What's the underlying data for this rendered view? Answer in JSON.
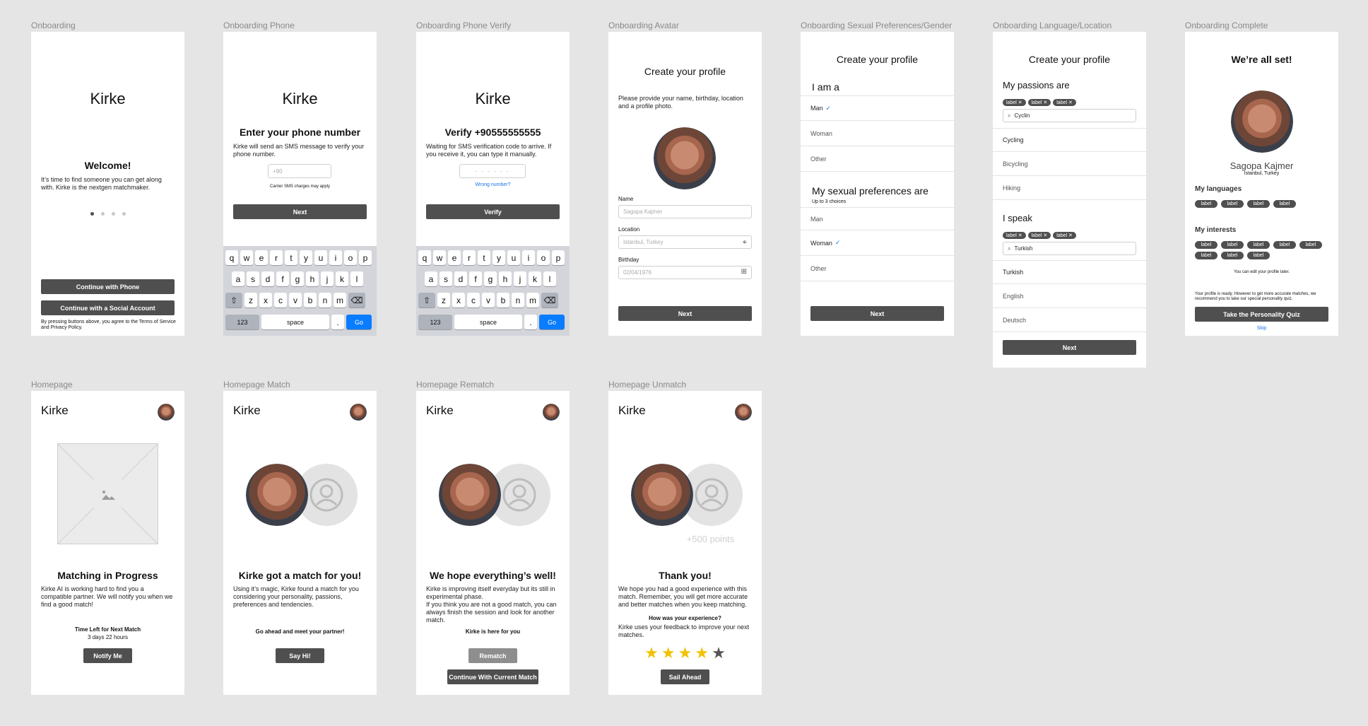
{
  "frames": {
    "onboarding": {
      "label": "Onboarding",
      "title": "Kirke",
      "welcome": "Welcome!",
      "body": "It’s time to find someone you can get along with. Kirke is the nextgen matchmaker.",
      "phone_button": "Continue with Phone",
      "social_button": "Continue with a Social Account",
      "terms": "By pressing buttons above, you agree to the Terms of Service and Privacy Policy.",
      "pager_active": 1,
      "pager_count": 4
    },
    "phone": {
      "label": "Onboarding Phone",
      "title": "Kirke",
      "heading": "Enter your phone number",
      "body": "Kirke will send an SMS message to verify your phone number.",
      "input_placeholder": "+90",
      "note": "Carrier SMS charges may apply",
      "next": "Next"
    },
    "verify": {
      "label": "Onboarding Phone Verify",
      "title": "Kirke",
      "heading": "Verify +90555555555",
      "body": "Waiting for SMS verification code to arrive. If you receive it, you can type it manually.",
      "code_placeholder": "- - - - - -",
      "wrong": "Wrong number?",
      "verify": "Verify"
    },
    "keyboard": {
      "row1": [
        "q",
        "w",
        "e",
        "r",
        "t",
        "y",
        "u",
        "i",
        "o",
        "p"
      ],
      "row2": [
        "a",
        "s",
        "d",
        "f",
        "g",
        "h",
        "j",
        "k",
        "l"
      ],
      "row3": [
        "z",
        "x",
        "c",
        "v",
        "b",
        "n",
        "m"
      ],
      "num": "123",
      "space": "space",
      "dot": ".",
      "go": "Go"
    },
    "avatar": {
      "label": "Onboarding Avatar",
      "heading": "Create your profile",
      "body": "Please provide your name, birthday, location and a profile photo.",
      "name_label": "Name",
      "name_value": "Sagopa Kajmer",
      "location_label": "Location",
      "location_value": "Istanbul, Turkey",
      "birthday_label": "Birthday",
      "birthday_value": "02/04/1976",
      "next": "Next"
    },
    "prefs": {
      "label": "Onboarding Sexual Preferences/Gender",
      "heading": "Create your profile",
      "iam": "I am a",
      "iam_options": [
        "Man",
        "Woman",
        "Other"
      ],
      "iam_selected": "Man",
      "prefs_heading": "My sexual preferences are",
      "prefs_sub": "Up to 3 choices",
      "pref_options": [
        "Man",
        "Woman",
        "Other"
      ],
      "pref_selected": "Woman",
      "next": "Next"
    },
    "language": {
      "label": "Onboarding Language/Location",
      "heading": "Create your profile",
      "passions": "My passions are",
      "passion_chips": [
        "label",
        "label",
        "label"
      ],
      "passion_search": "Cyclin",
      "passion_results": [
        "Cycling",
        "Bicycling",
        "Hiking"
      ],
      "speak": "I speak",
      "speak_chips": [
        "label",
        "label",
        "label"
      ],
      "speak_search": "Turkish",
      "speak_results": [
        "Turkish",
        "English",
        "Deutsch"
      ],
      "next": "Next"
    },
    "complete": {
      "label": "Onboarding Complete",
      "heading": "We’re all set!",
      "name": "Sagopa Kajmer",
      "location": "Istanbul, Turkey",
      "languages_heading": "My languages",
      "languages": [
        "label",
        "label",
        "label",
        "label"
      ],
      "interests_heading": "My interests",
      "interests": [
        "label",
        "label",
        "label",
        "label",
        "label",
        "label",
        "label",
        "label"
      ],
      "edit_note": "You can edit your profile later.",
      "ready_note": "Your profile is ready. However to get more accurate matches, we recommend you to take our special personality quiz.",
      "quiz": "Take the Personality Quiz",
      "skip": "Skip"
    },
    "home": {
      "label": "Homepage",
      "title": "Kirke",
      "heading": "Matching in Progress",
      "body": "Kirke AI is working hard to find you a compatible partner. We will notify you when we find a good match!",
      "timer_label": "Time Left for Next Match",
      "timer_value": "3 days 22 hours",
      "notify": "Notify Me"
    },
    "match": {
      "label": "Homepage Match",
      "title": "Kirke",
      "heading": "Kirke got a match for you!",
      "body": "Using it’s magic, Kirke found a match for you considering your personality, passions, preferences and tendencies.",
      "cta_text": "Go ahead and meet your partner!",
      "sayhi": "Say Hi!"
    },
    "rematch": {
      "label": "Homepage Rematch",
      "title": "Kirke",
      "heading": "We hope everything’s well!",
      "body": "Kirke is improving itself everyday but its still in experimental phase.\nIf you think you are not a good match, you can always finish the session and look for another match.",
      "cta_text": "Kirke is here for you",
      "rematch": "Rematch",
      "continue": "Continue With Current Match"
    },
    "unmatch": {
      "label": "Homepage Unmatch",
      "title": "Kirke",
      "points": "+500 points",
      "heading": "Thank you!",
      "body": "We hope you had a good experience with this match. Remember, you will get more accurate and better matches when you keep matching.",
      "question": "How was your experience?",
      "question_sub": "Kirke uses your feedback to improve your next matches.",
      "rating": 4,
      "rating_max": 5,
      "sail": "Sail Ahead"
    }
  },
  "colors": {
    "button": "#4f4f4f",
    "accent_blue": "#0a7cff",
    "star": "#f2c200",
    "canvas": "#e5e5e5"
  }
}
